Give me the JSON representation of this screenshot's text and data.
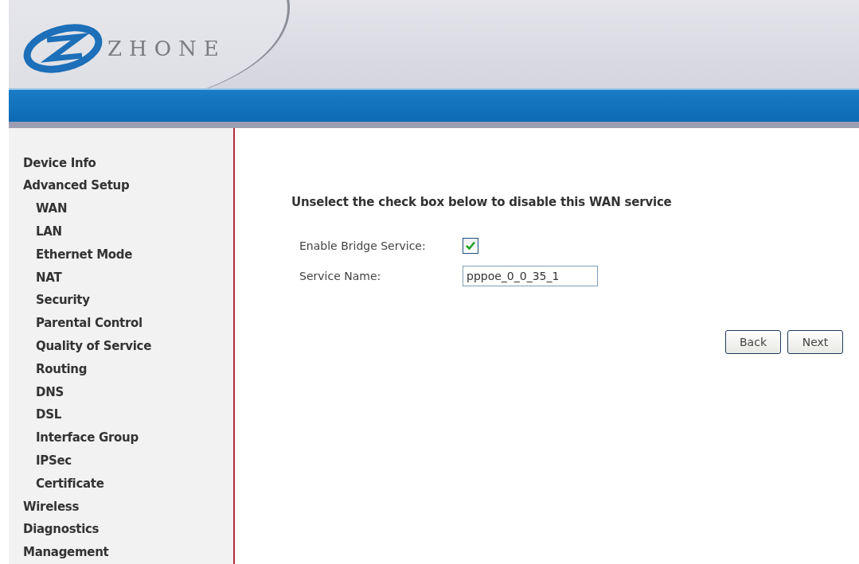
{
  "logo": {
    "text": "ZHONE"
  },
  "sidebar": {
    "items": [
      {
        "label": "Device Info"
      },
      {
        "label": "Advanced Setup",
        "children": [
          {
            "label": "WAN"
          },
          {
            "label": "LAN"
          },
          {
            "label": "Ethernet Mode"
          },
          {
            "label": "NAT"
          },
          {
            "label": "Security"
          },
          {
            "label": "Parental Control"
          },
          {
            "label": "Quality of Service"
          },
          {
            "label": "Routing"
          },
          {
            "label": "DNS"
          },
          {
            "label": "DSL"
          },
          {
            "label": "Interface Group"
          },
          {
            "label": "IPSec"
          },
          {
            "label": "Certificate"
          }
        ]
      },
      {
        "label": "Wireless"
      },
      {
        "label": "Diagnostics"
      },
      {
        "label": "Management"
      }
    ]
  },
  "form": {
    "heading": "Unselect the check box below to disable this WAN service",
    "enable_bridge": {
      "label": "Enable Bridge Service:",
      "checked": true
    },
    "service_name": {
      "label": "Service Name:",
      "value": "pppoe_0_0_35_1"
    },
    "buttons": [
      "Back",
      "Next"
    ]
  }
}
